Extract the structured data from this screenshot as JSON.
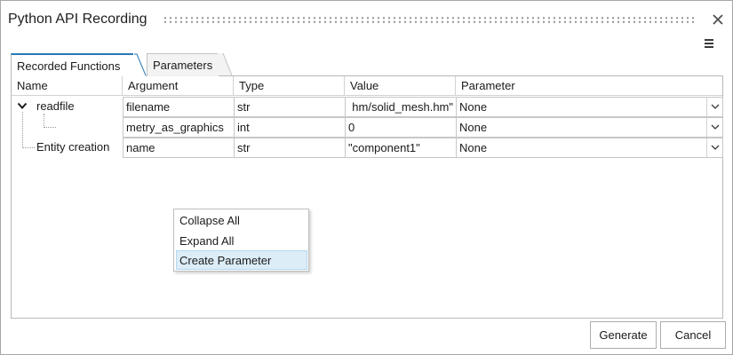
{
  "window": {
    "title": "Python API Recording"
  },
  "tabs": [
    {
      "label": "Recorded Functions",
      "active": true
    },
    {
      "label": "Parameters",
      "active": false
    }
  ],
  "table": {
    "columns": [
      "Name",
      "Argument",
      "Type",
      "Value",
      "Parameter"
    ],
    "rows": [
      {
        "name": "readfile",
        "expanded": true,
        "argument": "filename",
        "type": "str",
        "value": "hm/solid_mesh.hm\"",
        "parameter": "None"
      },
      {
        "name": "",
        "argument": "metry_as_graphics",
        "type": "int",
        "value": "0",
        "parameter": "None"
      },
      {
        "name": "Entity creation",
        "argument": "name",
        "type": "str",
        "value": "\"component1\"",
        "parameter": "None"
      }
    ]
  },
  "context_menu": {
    "items": [
      {
        "label": "Collapse All",
        "highlighted": false
      },
      {
        "label": "Expand All",
        "highlighted": false
      },
      {
        "label": "Create Parameter",
        "highlighted": true
      }
    ]
  },
  "buttons": {
    "generate": "Generate",
    "cancel": "Cancel"
  },
  "icons": {
    "close": "close-icon",
    "menu": "hamburger-menu-icon",
    "expand": "chevron-down-icon",
    "combo": "dropdown-arrow-icon"
  },
  "colors": {
    "tab_accent": "#2a7ab5",
    "menu_highlight": "#dcedf8"
  }
}
